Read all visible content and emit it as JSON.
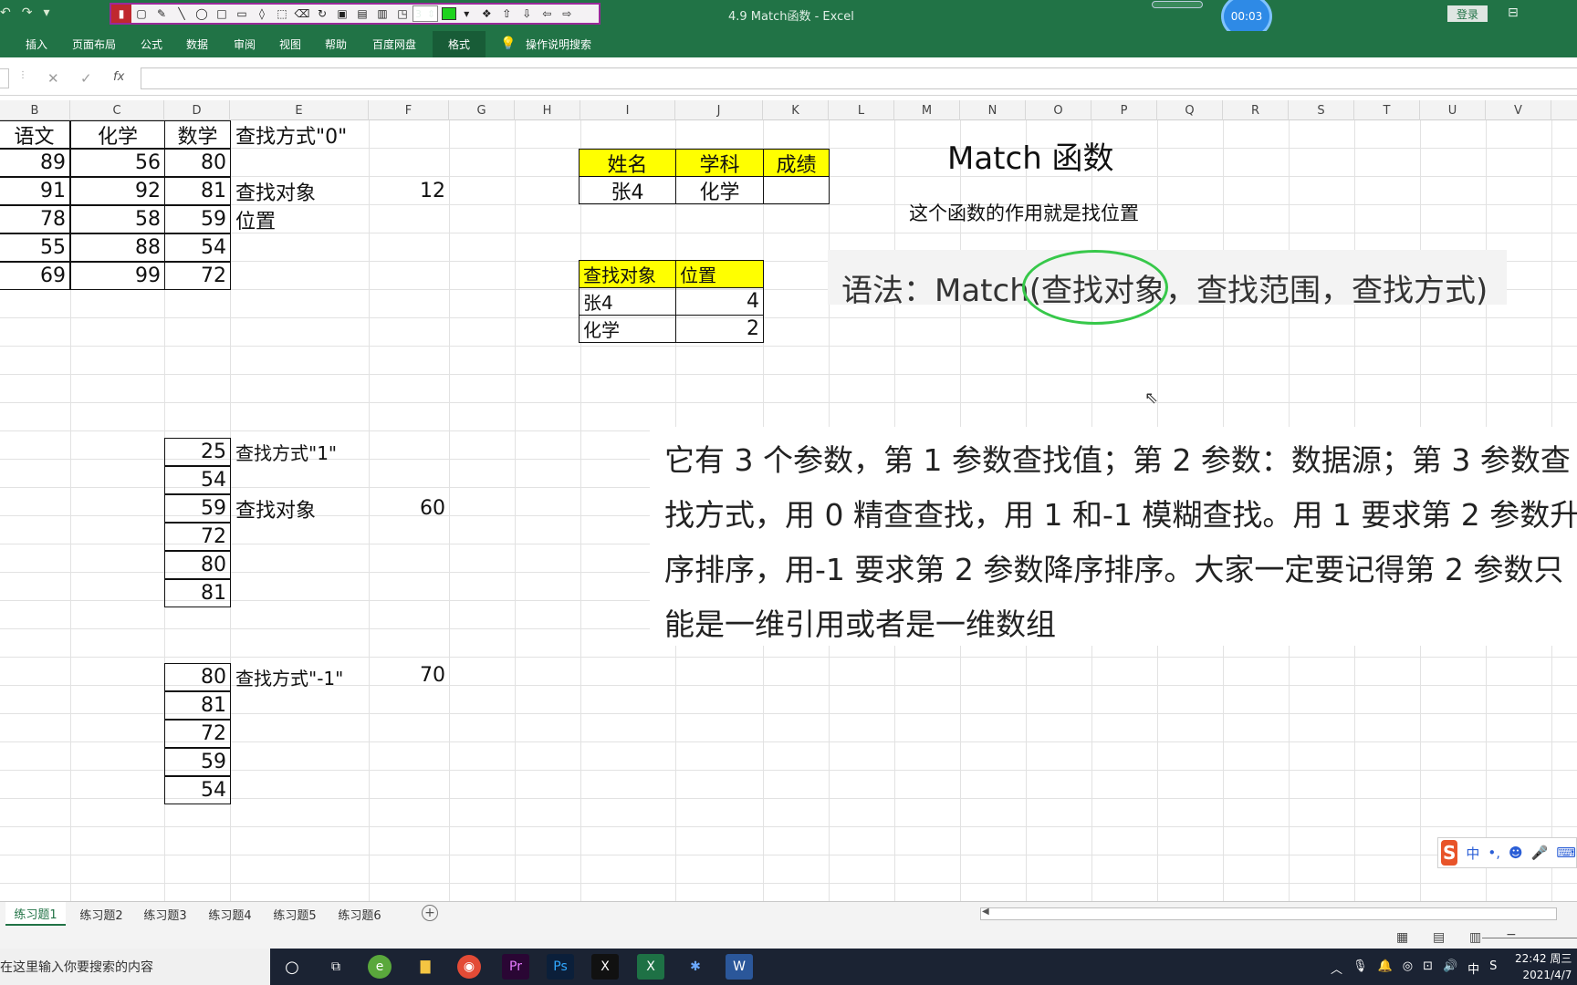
{
  "window": {
    "title": "4.9 Match函数  -  Excel",
    "timer": "00:03",
    "login": "登录"
  },
  "drawbar": {
    "line_width": "3"
  },
  "ribbon": {
    "tabs": [
      "插入",
      "页面布局",
      "公式",
      "数据",
      "审阅",
      "视图",
      "帮助",
      "百度网盘",
      "格式"
    ],
    "active_tab": "格式",
    "search": "操作说明搜索"
  },
  "formula_bar": {
    "cancel": "✕",
    "enter": "✓",
    "fx": "fx",
    "value": ""
  },
  "columns": [
    "B",
    "C",
    "D",
    "E",
    "F",
    "G",
    "H",
    "I",
    "J",
    "K",
    "L",
    "M",
    "N",
    "O",
    "P",
    "Q",
    "R",
    "S",
    "T",
    "U",
    "V"
  ],
  "table_main": {
    "headers": [
      "语文",
      "化学",
      "数学"
    ],
    "rows": [
      [
        "89",
        "56",
        "80"
      ],
      [
        "91",
        "92",
        "81"
      ],
      [
        "78",
        "58",
        "59"
      ],
      [
        "55",
        "88",
        "54"
      ],
      [
        "69",
        "99",
        "72"
      ]
    ]
  },
  "lookup0": {
    "mode": "查找方式\"0\"",
    "target_label": "查找对象",
    "target_value": "12",
    "position_label": "位置"
  },
  "lookup_table": {
    "headers": [
      "姓名",
      "学科",
      "成绩"
    ],
    "row": [
      "张4",
      "化学",
      ""
    ]
  },
  "result_table": {
    "headers": [
      "查找对象",
      "位置"
    ],
    "rows": [
      [
        "张4",
        "4"
      ],
      [
        "化学",
        "2"
      ]
    ]
  },
  "lookup1": {
    "values": [
      "25",
      "54",
      "59",
      "72",
      "80",
      "81"
    ],
    "mode": "查找方式\"1\"",
    "target_label": "查找对象",
    "target_value": "60"
  },
  "lookup_neg1": {
    "values": [
      "80",
      "81",
      "72",
      "59",
      "54"
    ],
    "mode": "查找方式\"-1\"",
    "target_value": "70"
  },
  "heading": "Match 函数",
  "description": "这个函数的作用就是找位置",
  "syntax": "语法：Match(查找对象，查找范围，查找方式)",
  "paragraph": [
    "它有 3 个参数，第 1 参数查找值；第 2 参数：数据源；第 3 参数查",
    "找方式，用 0 精查查找，用 1 和-1 模糊查找。用 1 要求第 2 参数升",
    "序排序，用-1 要求第 2 参数降序排序。大家一定要记得第 2 参数只",
    "能是一维引用或者是一维数组"
  ],
  "ime": {
    "lang": "中",
    "punct": "•,",
    "emoji": "☻",
    "mic": "🎤",
    "keyboard": "⌨"
  },
  "sheets": [
    "练习题1",
    "练习题2",
    "练习题3",
    "练习题4",
    "练习题5",
    "练习题6"
  ],
  "active_sheet": "练习题1",
  "taskbar": {
    "search_placeholder": "在这里输入你要搜索的内容",
    "apps": [
      "Pr",
      "Ps",
      "X",
      "W"
    ]
  },
  "tray": {
    "lang": "中",
    "time": "22:42 周三",
    "date": "2021/4/7"
  },
  "colors": {
    "excel_green": "#217346",
    "highlight": "#ffff00",
    "circle": "#37c84a"
  }
}
